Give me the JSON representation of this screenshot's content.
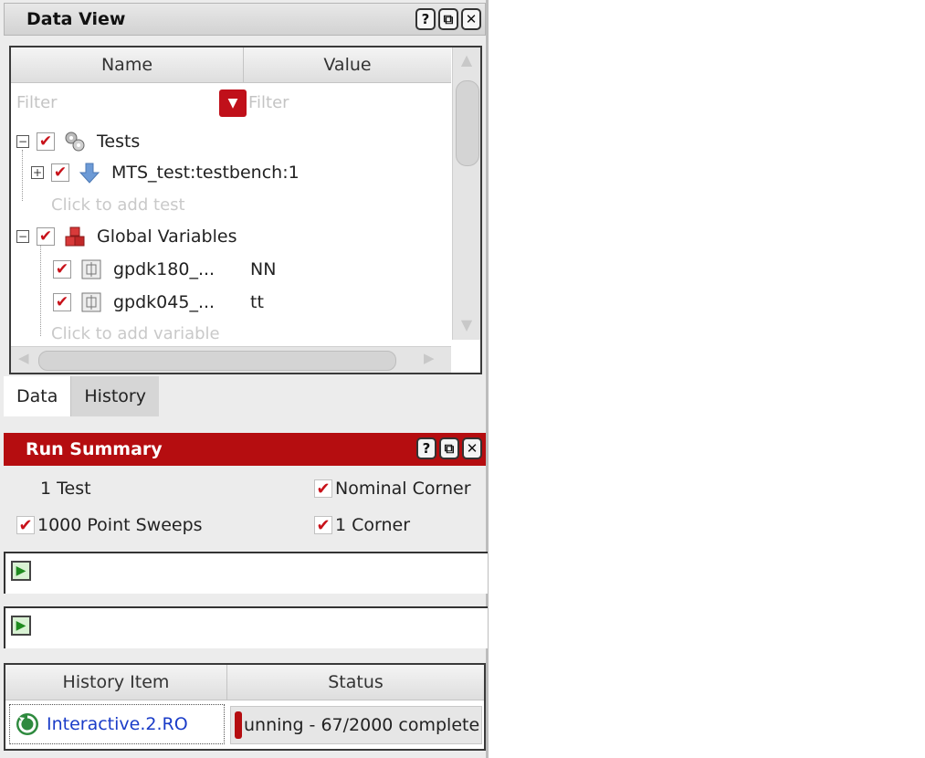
{
  "data_view": {
    "title": "Data View",
    "title_buttons": [
      "?",
      "⧉",
      "✕"
    ],
    "columns": {
      "name": "Name",
      "value": "Value"
    },
    "filter": {
      "name_placeholder": "Filter",
      "value_placeholder": "Filter"
    },
    "tree": {
      "tests": {
        "label": "Tests"
      },
      "test_item": {
        "label": "MTS_test:testbench:1"
      },
      "add_test": "Click to add test",
      "global_vars": {
        "label": "Global Variables"
      },
      "vars": [
        {
          "name": "gpdk180_...",
          "value": "NN"
        },
        {
          "name": "gpdk045_...",
          "value": "tt"
        }
      ],
      "add_variable": "Click to add variable"
    },
    "tabs": [
      {
        "label": "Data"
      },
      {
        "label": "History"
      }
    ]
  },
  "run_summary": {
    "title": "Run Summary",
    "title_buttons": [
      "?",
      "⧉",
      "✕"
    ],
    "tests_count": "1 Test",
    "nominal_corner": "Nominal Corner",
    "point_sweeps": "1000 Point Sweeps",
    "corners": "1 Corner"
  },
  "history_table": {
    "columns": {
      "item": "History Item",
      "status": "Status"
    },
    "rows": [
      {
        "item": "Interactive.2.RO",
        "status": "unning - 67/2000 complete"
      }
    ]
  },
  "colors": {
    "accent_red": "#b50d10",
    "link_blue": "#1a3cc8",
    "check_red": "#c8121a"
  }
}
